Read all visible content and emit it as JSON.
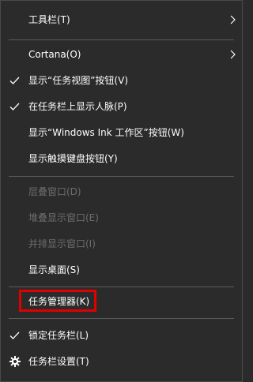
{
  "menu": {
    "items": [
      {
        "label": "工具栏(T)",
        "submenu": true
      },
      {
        "label": "Cortana(O)",
        "submenu": true
      },
      {
        "label": "显示“任务视图”按钮(V)",
        "checked": true
      },
      {
        "label": "在任务栏上显示人脉(P)",
        "checked": true
      },
      {
        "label": "显示“Windows Ink 工作区”按钮(W)"
      },
      {
        "label": "显示触摸键盘按钮(Y)"
      },
      {
        "label": "层叠窗口(D)",
        "disabled": true
      },
      {
        "label": "堆叠显示窗口(E)",
        "disabled": true
      },
      {
        "label": "并排显示窗口(I)",
        "disabled": true
      },
      {
        "label": "显示桌面(S)"
      },
      {
        "label": "任务管理器(K)",
        "highlighted": true
      },
      {
        "label": "锁定任务栏(L)",
        "checked": true
      },
      {
        "label": "任务栏设置(T)",
        "icon": "gear-icon"
      }
    ]
  },
  "colors": {
    "background": "#2b2b2b",
    "text": "#ffffff",
    "disabled_text": "#6d6d6d",
    "separator": "#5a5a5a",
    "highlight_border": "#e00000"
  }
}
